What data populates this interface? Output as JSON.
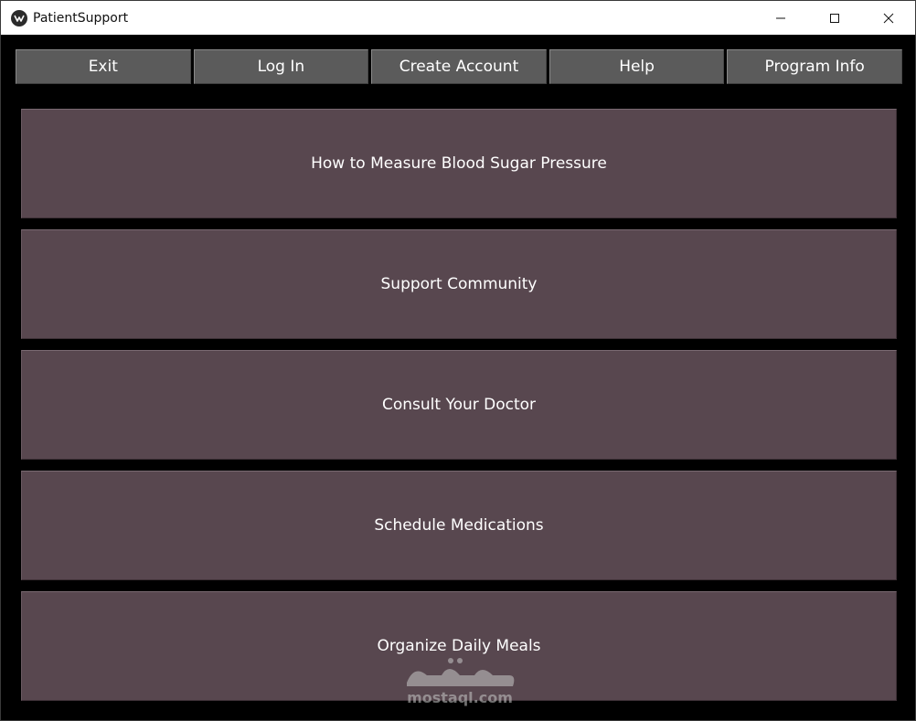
{
  "window": {
    "title": "PatientSupport"
  },
  "toolbar": {
    "buttons": [
      {
        "label": "Exit"
      },
      {
        "label": "Log In"
      },
      {
        "label": "Create Account"
      },
      {
        "label": "Help"
      },
      {
        "label": "Program Info"
      }
    ]
  },
  "menu": {
    "items": [
      {
        "label": "How to Measure Blood Sugar Pressure"
      },
      {
        "label": "Support Community"
      },
      {
        "label": "Consult Your Doctor"
      },
      {
        "label": "Schedule Medications"
      },
      {
        "label": "Organize Daily Meals"
      }
    ]
  },
  "watermark": {
    "text": "mostaql.com"
  },
  "colors": {
    "background": "#000000",
    "toolbar_button": "#5b5b5b",
    "menu_button": "#58474f",
    "text": "#ffffff"
  }
}
